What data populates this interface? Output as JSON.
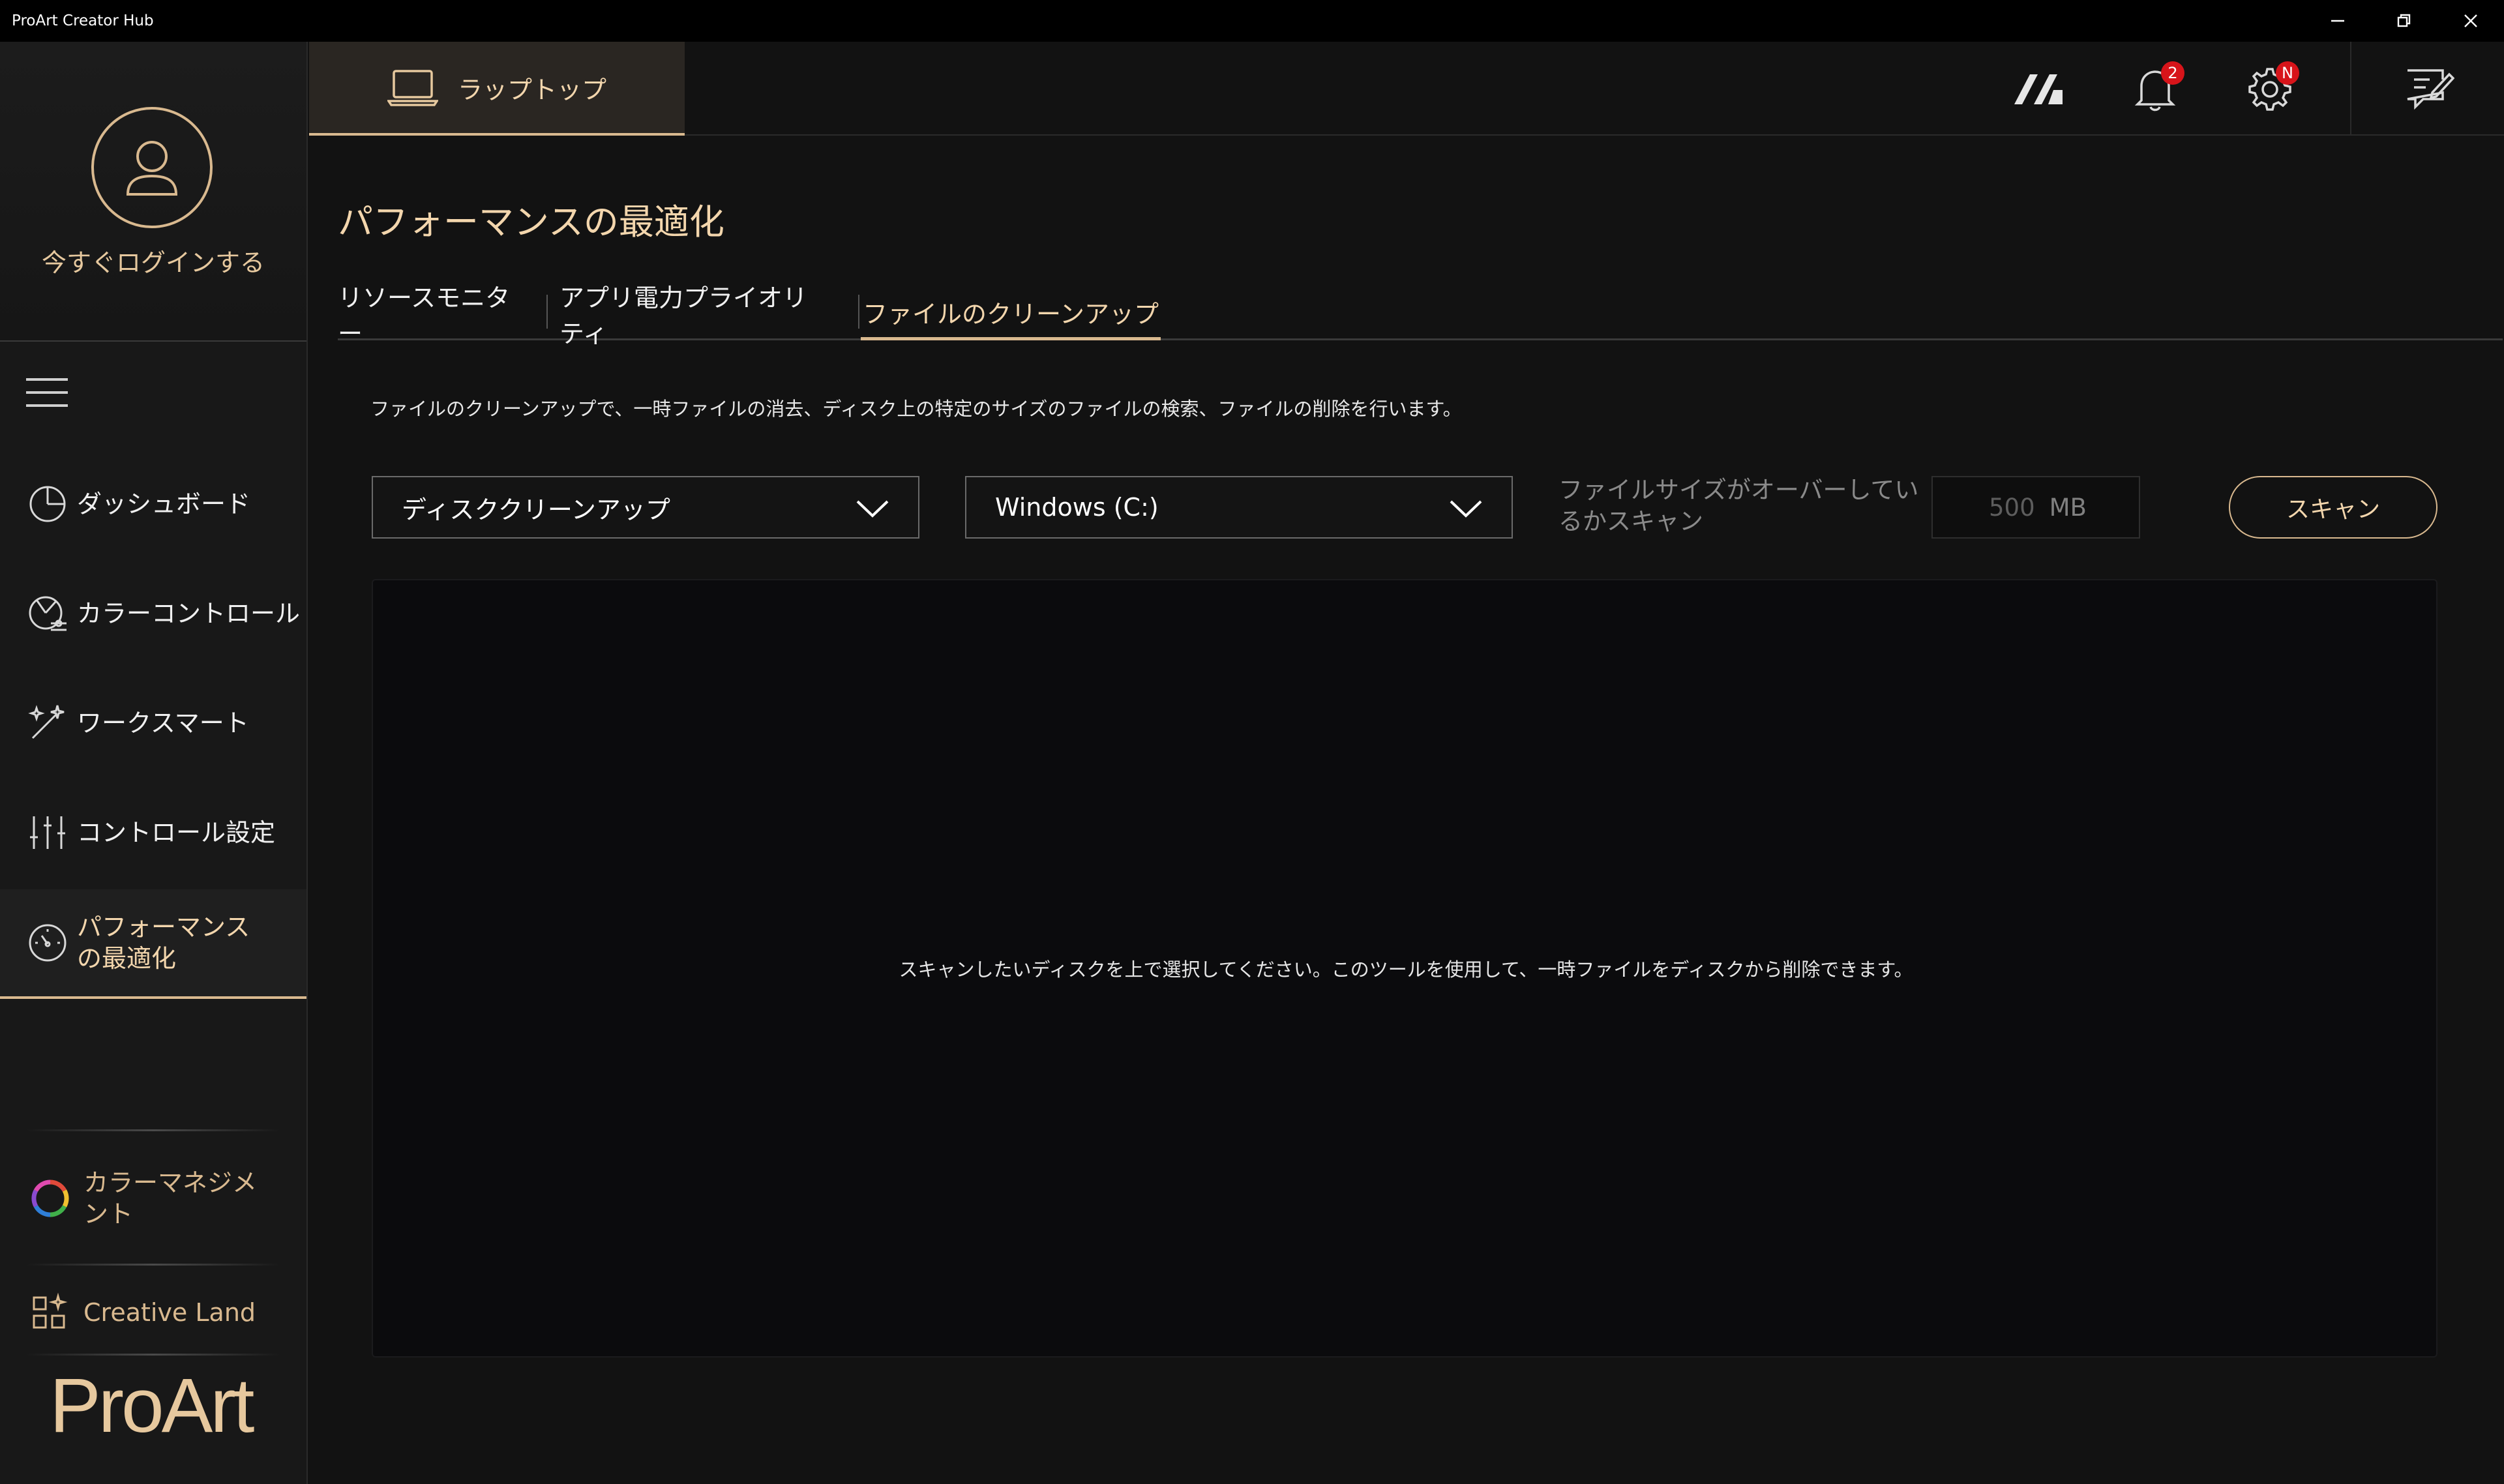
{
  "window": {
    "title": "ProArt Creator Hub"
  },
  "sidebar": {
    "login_label": "今すぐログインする",
    "items": [
      {
        "label": "ダッシュボード",
        "icon": "dashboard-icon"
      },
      {
        "label": "カラーコントロール",
        "icon": "color-control-icon"
      },
      {
        "label": "ワークスマート",
        "icon": "magic-wand-icon"
      },
      {
        "label": "コントロール設定",
        "icon": "sliders-icon"
      },
      {
        "label": "パフォーマンスの最適化",
        "icon": "gauge-icon",
        "active": true
      }
    ],
    "bottom_items": [
      {
        "label": "カラーマネジメント",
        "icon": "color-wheel-icon"
      },
      {
        "label": "Creative Land",
        "icon": "apps-grid-icon"
      }
    ],
    "logo": "ProArt"
  },
  "header": {
    "device_tab": "ラップトップ",
    "notifications_badge": "2",
    "settings_badge": "N"
  },
  "main": {
    "title": "パフォーマンスの最適化",
    "tabs": [
      {
        "label": "リソースモニター"
      },
      {
        "label": "アプリ電力プライオリティ"
      },
      {
        "label": "ファイルのクリーンアップ",
        "active": true
      }
    ],
    "description": "ファイルのクリーンアップで、一時ファイルの消去、ディスク上の特定のサイズのファイルの検索、ファイルの削除を行います。",
    "mode_select": "ディスククリーンアップ",
    "drive_select": "Windows (C:)",
    "size_label": "ファイルサイズがオーバーしているかスキャン",
    "size_value": "500",
    "size_unit": "MB",
    "scan_button": "スキャン",
    "empty_message": "スキャンしたいディスクを上で選択してください。このツールを使用して、一時ファイルをディスクから削除できます。"
  },
  "colors": {
    "accent": "#d9b98f",
    "background": "#121212",
    "badge": "#d7141a"
  }
}
